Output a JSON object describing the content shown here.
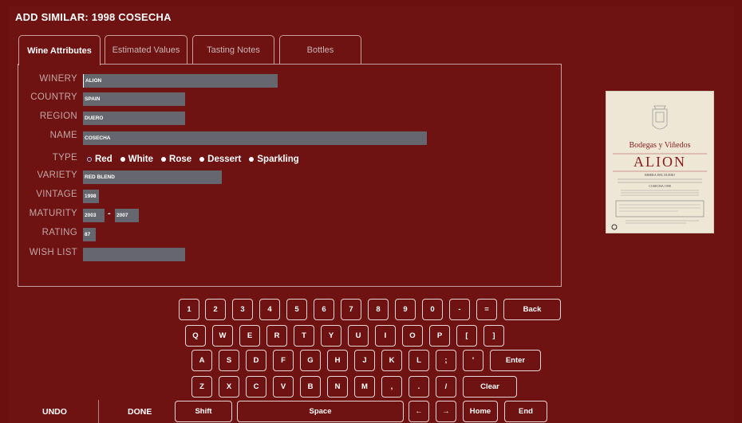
{
  "header": {
    "title": "ADD SIMILAR: 1998 COSECHA"
  },
  "tabs": [
    {
      "label": "Wine Attributes"
    },
    {
      "label": "Estimated Values"
    },
    {
      "label": "Tasting Notes"
    },
    {
      "label": "Bottles"
    }
  ],
  "form": {
    "winery": {
      "label": "WINERY",
      "value": "ALION"
    },
    "country": {
      "label": "COUNTRY",
      "value": "SPAIN"
    },
    "region": {
      "label": "REGION",
      "value": "DUERO"
    },
    "name": {
      "label": "NAME",
      "value": "COSECHA"
    },
    "type": {
      "label": "TYPE",
      "options": [
        "Red",
        "White",
        "Rose",
        "Dessert",
        "Sparkling"
      ],
      "selected": "Red"
    },
    "variety": {
      "label": "VARIETY",
      "value": "RED BLEND"
    },
    "vintage": {
      "label": "VINTAGE",
      "value": "1998"
    },
    "maturity": {
      "label": "MATURITY",
      "from": "2003",
      "separator": "-",
      "to": "2007"
    },
    "rating": {
      "label": "RATING",
      "value": "87"
    },
    "wish_list": {
      "label": "WISH LIST",
      "value": ""
    }
  },
  "wine_label": {
    "brand": "Bodegas y Viñedos",
    "name": "ALION",
    "line1": "RIBERA DEL DUERO",
    "line2": "COSECHA 1998"
  },
  "keyboard": {
    "row1": [
      "1",
      "2",
      "3",
      "4",
      "5",
      "6",
      "7",
      "8",
      "9",
      "0",
      "-",
      "=",
      "Back"
    ],
    "row2": [
      "Q",
      "W",
      "E",
      "R",
      "T",
      "Y",
      "U",
      "I",
      "O",
      "P",
      "[",
      "]"
    ],
    "row3": [
      "A",
      "S",
      "D",
      "F",
      "G",
      "H",
      "J",
      "K",
      "L",
      ";",
      "'",
      "Enter"
    ],
    "row4": [
      "Z",
      "X",
      "C",
      "V",
      "B",
      "N",
      "M",
      ",",
      ".",
      "/",
      "Clear"
    ],
    "row5": [
      "Shift",
      "Space",
      "←",
      "→",
      "Home",
      "End"
    ]
  },
  "footer": {
    "undo": "UNDO",
    "done": "DONE"
  }
}
